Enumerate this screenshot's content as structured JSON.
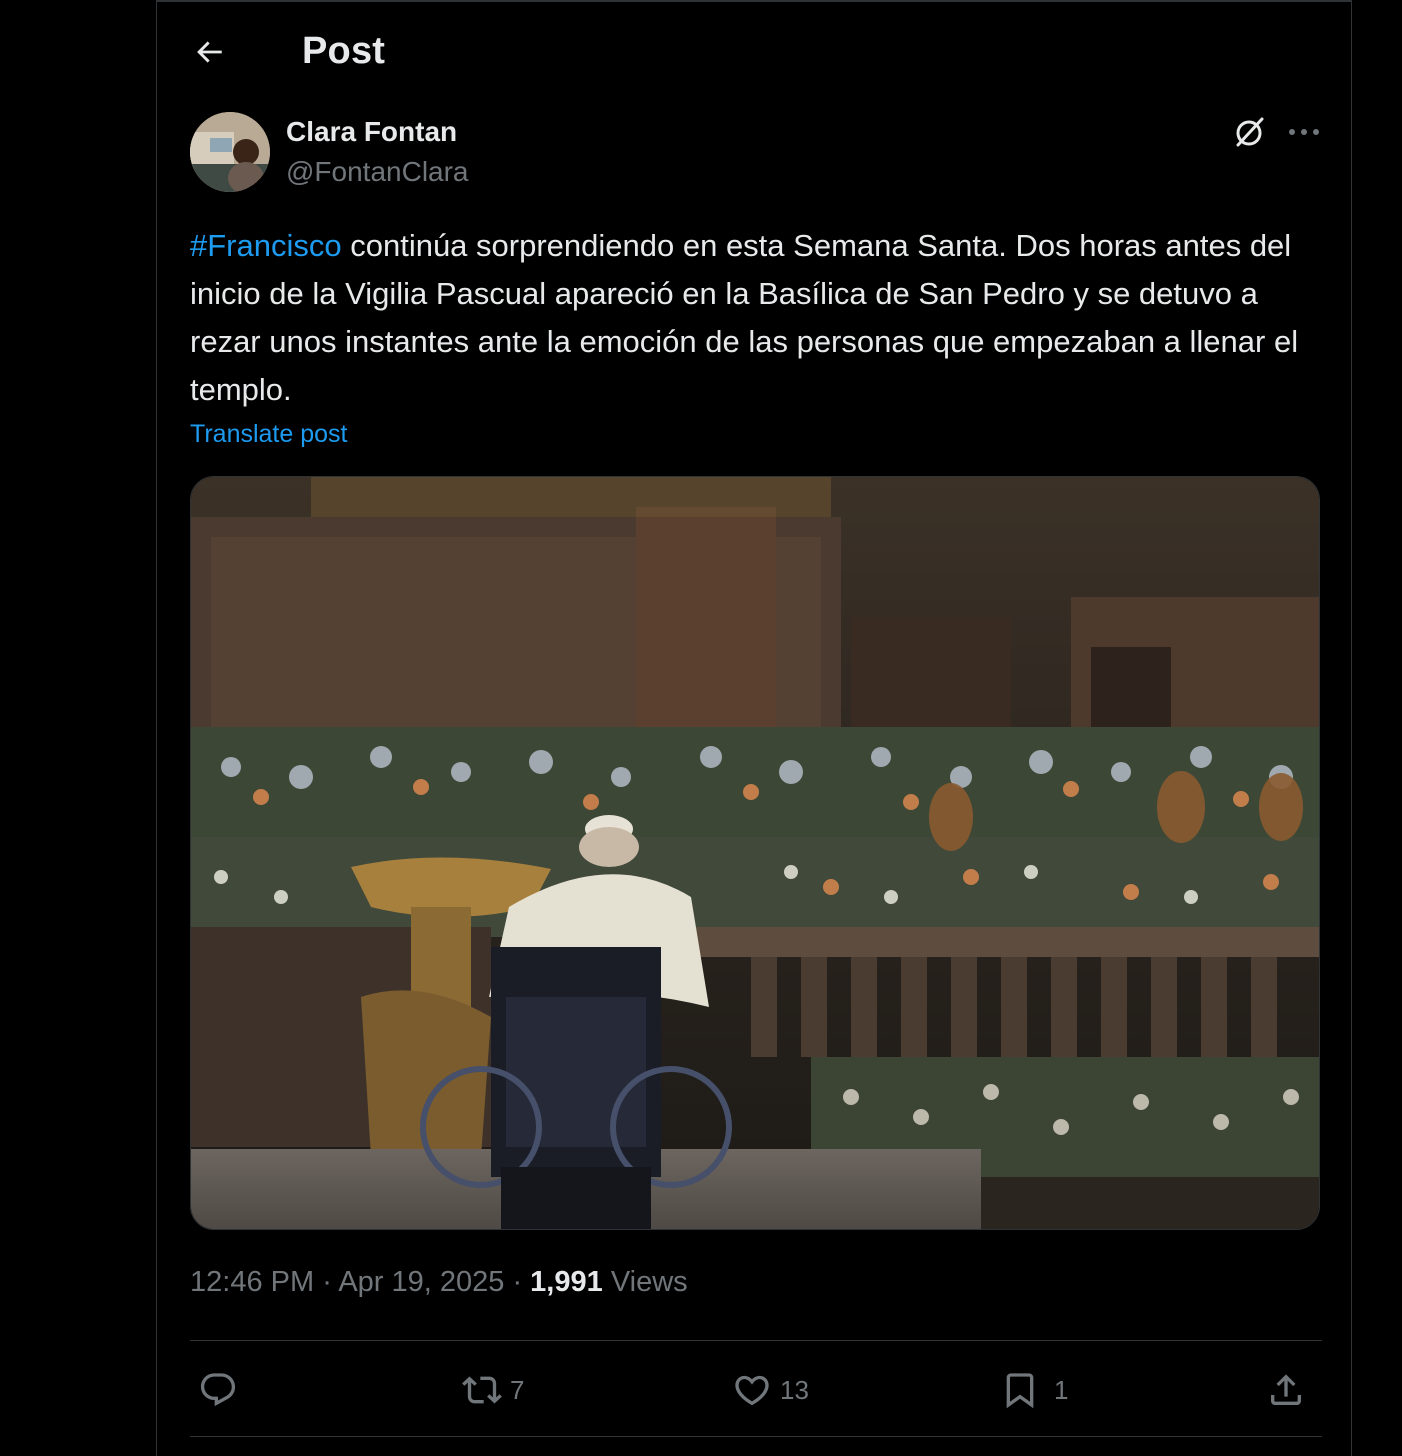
{
  "header": {
    "title": "Post"
  },
  "post": {
    "author_name": "Clara Fontan",
    "author_handle": "@FontanClara",
    "hashtag": "#Francisco",
    "body": " continúa sorprendiendo en esta Semana Santa. Dos horas antes del inicio de la Vigilia Pascual apareció en la Basílica de San Pedro y se detuvo a rezar unos instantes ante la emoción de las personas que empezaban a llenar el templo.",
    "translate_label": "Translate post",
    "time": "12:46 PM",
    "separator": " · ",
    "date": "Apr 19, 2025",
    "views_count": "1,991",
    "views_label": "Views"
  },
  "actions": {
    "replies": "",
    "reposts": "7",
    "likes": "13",
    "bookmarks": "1"
  },
  "colors": {
    "background": "#000000",
    "text": "#e7e9ea",
    "secondary": "#71767b",
    "accent": "#1d9bf0",
    "border": "#2f3336"
  },
  "icons": [
    "back-arrow-icon",
    "grok-icon",
    "more-icon",
    "reply-icon",
    "repost-icon",
    "like-icon",
    "bookmark-icon",
    "share-icon"
  ]
}
